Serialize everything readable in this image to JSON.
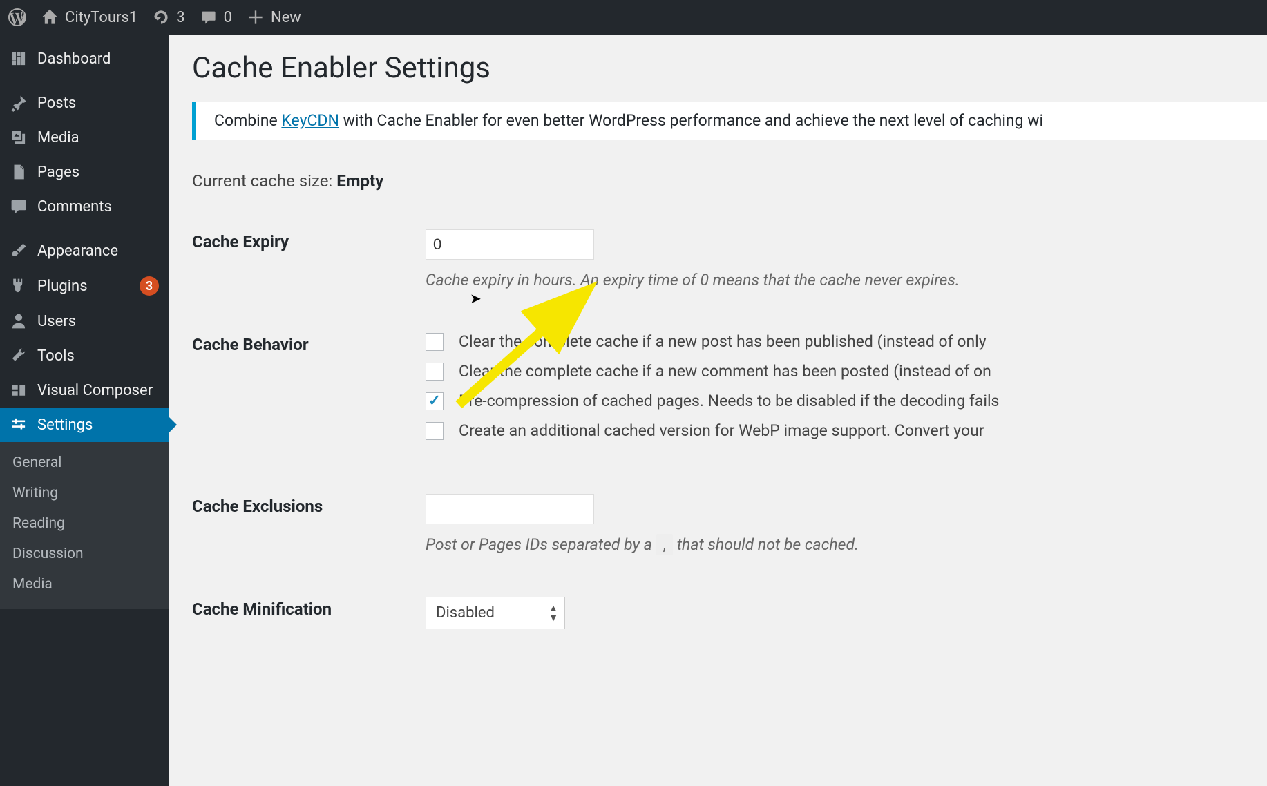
{
  "adminbar": {
    "site_name": "CityTours1",
    "updates_count": "3",
    "comments_count": "0",
    "new_label": "New"
  },
  "sidebar": {
    "dashboard": "Dashboard",
    "posts": "Posts",
    "media": "Media",
    "pages": "Pages",
    "comments": "Comments",
    "appearance": "Appearance",
    "plugins": "Plugins",
    "plugins_badge": "3",
    "users": "Users",
    "tools": "Tools",
    "visual_composer": "Visual Composer",
    "settings": "Settings",
    "sub": {
      "general": "General",
      "writing": "Writing",
      "reading": "Reading",
      "discussion": "Discussion",
      "media": "Media"
    }
  },
  "page": {
    "title": "Cache Enabler Settings",
    "notice_pre": "Combine ",
    "notice_link": "KeyCDN",
    "notice_post": " with Cache Enabler for even better WordPress performance and achieve the next level of caching wi",
    "cache_size_pre": "Current cache size: ",
    "cache_size_val": "Empty"
  },
  "form": {
    "expiry_label": "Cache Expiry",
    "expiry_value": "0",
    "expiry_desc": "Cache expiry in hours. An expiry time of 0 means that the cache never expires.",
    "behavior_label": "Cache Behavior",
    "behavior_opt1": "Clear the complete cache if a new post has been published (instead of only ",
    "behavior_opt2": "Clear the complete cache if a new comment has been posted (instead of on",
    "behavior_opt3": "Pre-compression of cached pages. Needs to be disabled if the decoding fails",
    "behavior_opt4": "Create an additional cached version for WebP image support. Convert your",
    "exclusions_label": "Cache Exclusions",
    "exclusions_value": "",
    "exclusions_desc_pre": "Post or Pages IDs separated by a ",
    "exclusions_sep": ",",
    "exclusions_desc_post": " that should not be cached.",
    "minification_label": "Cache Minification",
    "minification_value": "Disabled"
  }
}
